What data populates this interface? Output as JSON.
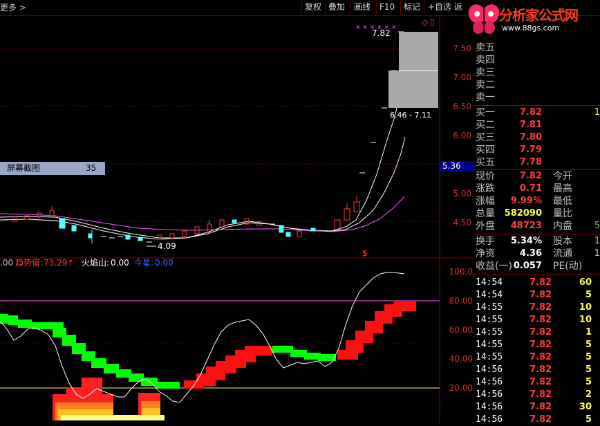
{
  "toolbar": {
    "more": "更多 >",
    "buttons": [
      "复权",
      "叠加",
      "画线",
      "F10",
      "标记",
      "+自选",
      "返"
    ],
    "icons": [
      "◇",
      "▯"
    ]
  },
  "logo": {
    "title": "分析家公式网",
    "url": "www.88gs.com"
  },
  "chart": {
    "high_label": "7.82",
    "low_label": "4.09",
    "range_label": "6.46 - 7.11",
    "current_price_box": "5.36",
    "marker": "$",
    "price_axis": [
      "7.50",
      "7.00",
      "6.50",
      "6.00",
      "5.50",
      "5.00",
      "4.50"
    ],
    "indicator_axis": [
      "100.0",
      "80.00",
      "60.00",
      "40.00",
      "20.00"
    ],
    "legend": {
      "prefix": ".00",
      "trend_label": "趋势值:",
      "trend_value": "73.29↑",
      "fire_label": "火焰山:",
      "fire_value": "0.00",
      "today_label": "今星:",
      "today_value": "0.00"
    },
    "tip": {
      "label": "屏幕截图",
      "value": "35"
    }
  },
  "quote": {
    "sells": [
      "卖五",
      "卖四",
      "卖三",
      "卖二",
      "卖一"
    ],
    "buys": [
      {
        "label": "买一",
        "price": "7.82",
        "vol": "1"
      },
      {
        "label": "买二",
        "price": "7.81",
        "vol": ""
      },
      {
        "label": "买三",
        "price": "7.80",
        "vol": ""
      },
      {
        "label": "买四",
        "price": "7.79",
        "vol": ""
      },
      {
        "label": "买五",
        "price": "7.78",
        "vol": ""
      }
    ],
    "stats": [
      {
        "l": "现价",
        "v": "7.82",
        "l2": "今开",
        "c": ""
      },
      {
        "l": "涨跌",
        "v": "0.71",
        "l2": "最高",
        "c": ""
      },
      {
        "l": "涨幅",
        "v": "9.99%",
        "l2": "最低",
        "c": ""
      },
      {
        "l": "总量",
        "v": "582090",
        "l2": "量比",
        "c": ""
      },
      {
        "l": "外盘",
        "v": "48723",
        "l2": "内盘",
        "c": "5"
      }
    ],
    "stats2": [
      {
        "l": "换手",
        "v": "5.34%",
        "l2": "股本",
        "c": "1"
      },
      {
        "l": "净资",
        "v": "4.36",
        "l2": "流通",
        "c": "1"
      },
      {
        "l": "收益(一)",
        "v": "0.057",
        "l2": "PE(动)",
        "c": ""
      }
    ],
    "ticks": [
      {
        "t": "14:54",
        "p": "7.82",
        "v": "60"
      },
      {
        "t": "14:54",
        "p": "7.82",
        "v": "5"
      },
      {
        "t": "14:55",
        "p": "7.82",
        "v": "10"
      },
      {
        "t": "14:55",
        "p": "7.82",
        "v": "10"
      },
      {
        "t": "14:55",
        "p": "7.82",
        "v": "1"
      },
      {
        "t": "14:55",
        "p": "7.82",
        "v": "5"
      },
      {
        "t": "14:55",
        "p": "7.82",
        "v": "5"
      },
      {
        "t": "14:56",
        "p": "7.82",
        "v": "5"
      },
      {
        "t": "14:56",
        "p": "7.82",
        "v": "5"
      },
      {
        "t": "14:56",
        "p": "7.82",
        "v": "2"
      },
      {
        "t": "14:56",
        "p": "7.82",
        "v": "30"
      },
      {
        "t": "14:56",
        "p": "7.82",
        "v": "5"
      }
    ]
  },
  "colors": {
    "up": "#ff3c3c",
    "down": "#54ffff",
    "bg": "#000000",
    "grid": "#8b0000"
  }
}
